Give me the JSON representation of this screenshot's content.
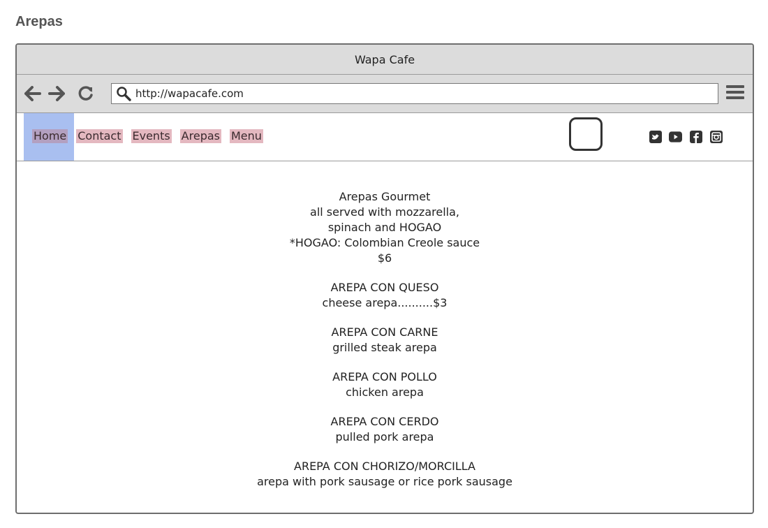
{
  "page": {
    "title": "Arepas"
  },
  "window": {
    "title": "Wapa Cafe"
  },
  "toolbar": {
    "back_icon": "arrow-left-icon",
    "forward_icon": "arrow-right-icon",
    "reload_icon": "reload-icon",
    "search_icon": "search-icon",
    "url": "http://wapacafe.com",
    "menu_icon": "hamburger-menu-icon"
  },
  "nav": {
    "items": [
      {
        "label": "Home"
      },
      {
        "label": "Contact"
      },
      {
        "label": "Events"
      },
      {
        "label": "Arepas"
      },
      {
        "label": "Menu"
      }
    ],
    "highlight_color": "#a9bff0",
    "link_color": "#e4b8c0"
  },
  "social": {
    "icons": [
      "twitter-icon",
      "youtube-icon",
      "facebook-icon",
      "instagram-icon"
    ]
  },
  "content": {
    "intro": [
      "Arepas Gourmet",
      "all served with mozzarella,",
      "spinach and HOGAO",
      "*HOGAO: Colombian Creole sauce",
      "$6"
    ],
    "items": [
      {
        "name": "AREPA CON QUESO",
        "desc": "cheese arepa..........$3"
      },
      {
        "name": "AREPA CON CARNE",
        "desc": "grilled steak arepa"
      },
      {
        "name": "AREPA CON POLLO",
        "desc": "chicken arepa"
      },
      {
        "name": "AREPA CON CERDO",
        "desc": "pulled pork arepa"
      },
      {
        "name": "AREPA CON CHORIZO/MORCILLA",
        "desc": "arepa with pork sausage or rice pork sausage"
      }
    ]
  }
}
